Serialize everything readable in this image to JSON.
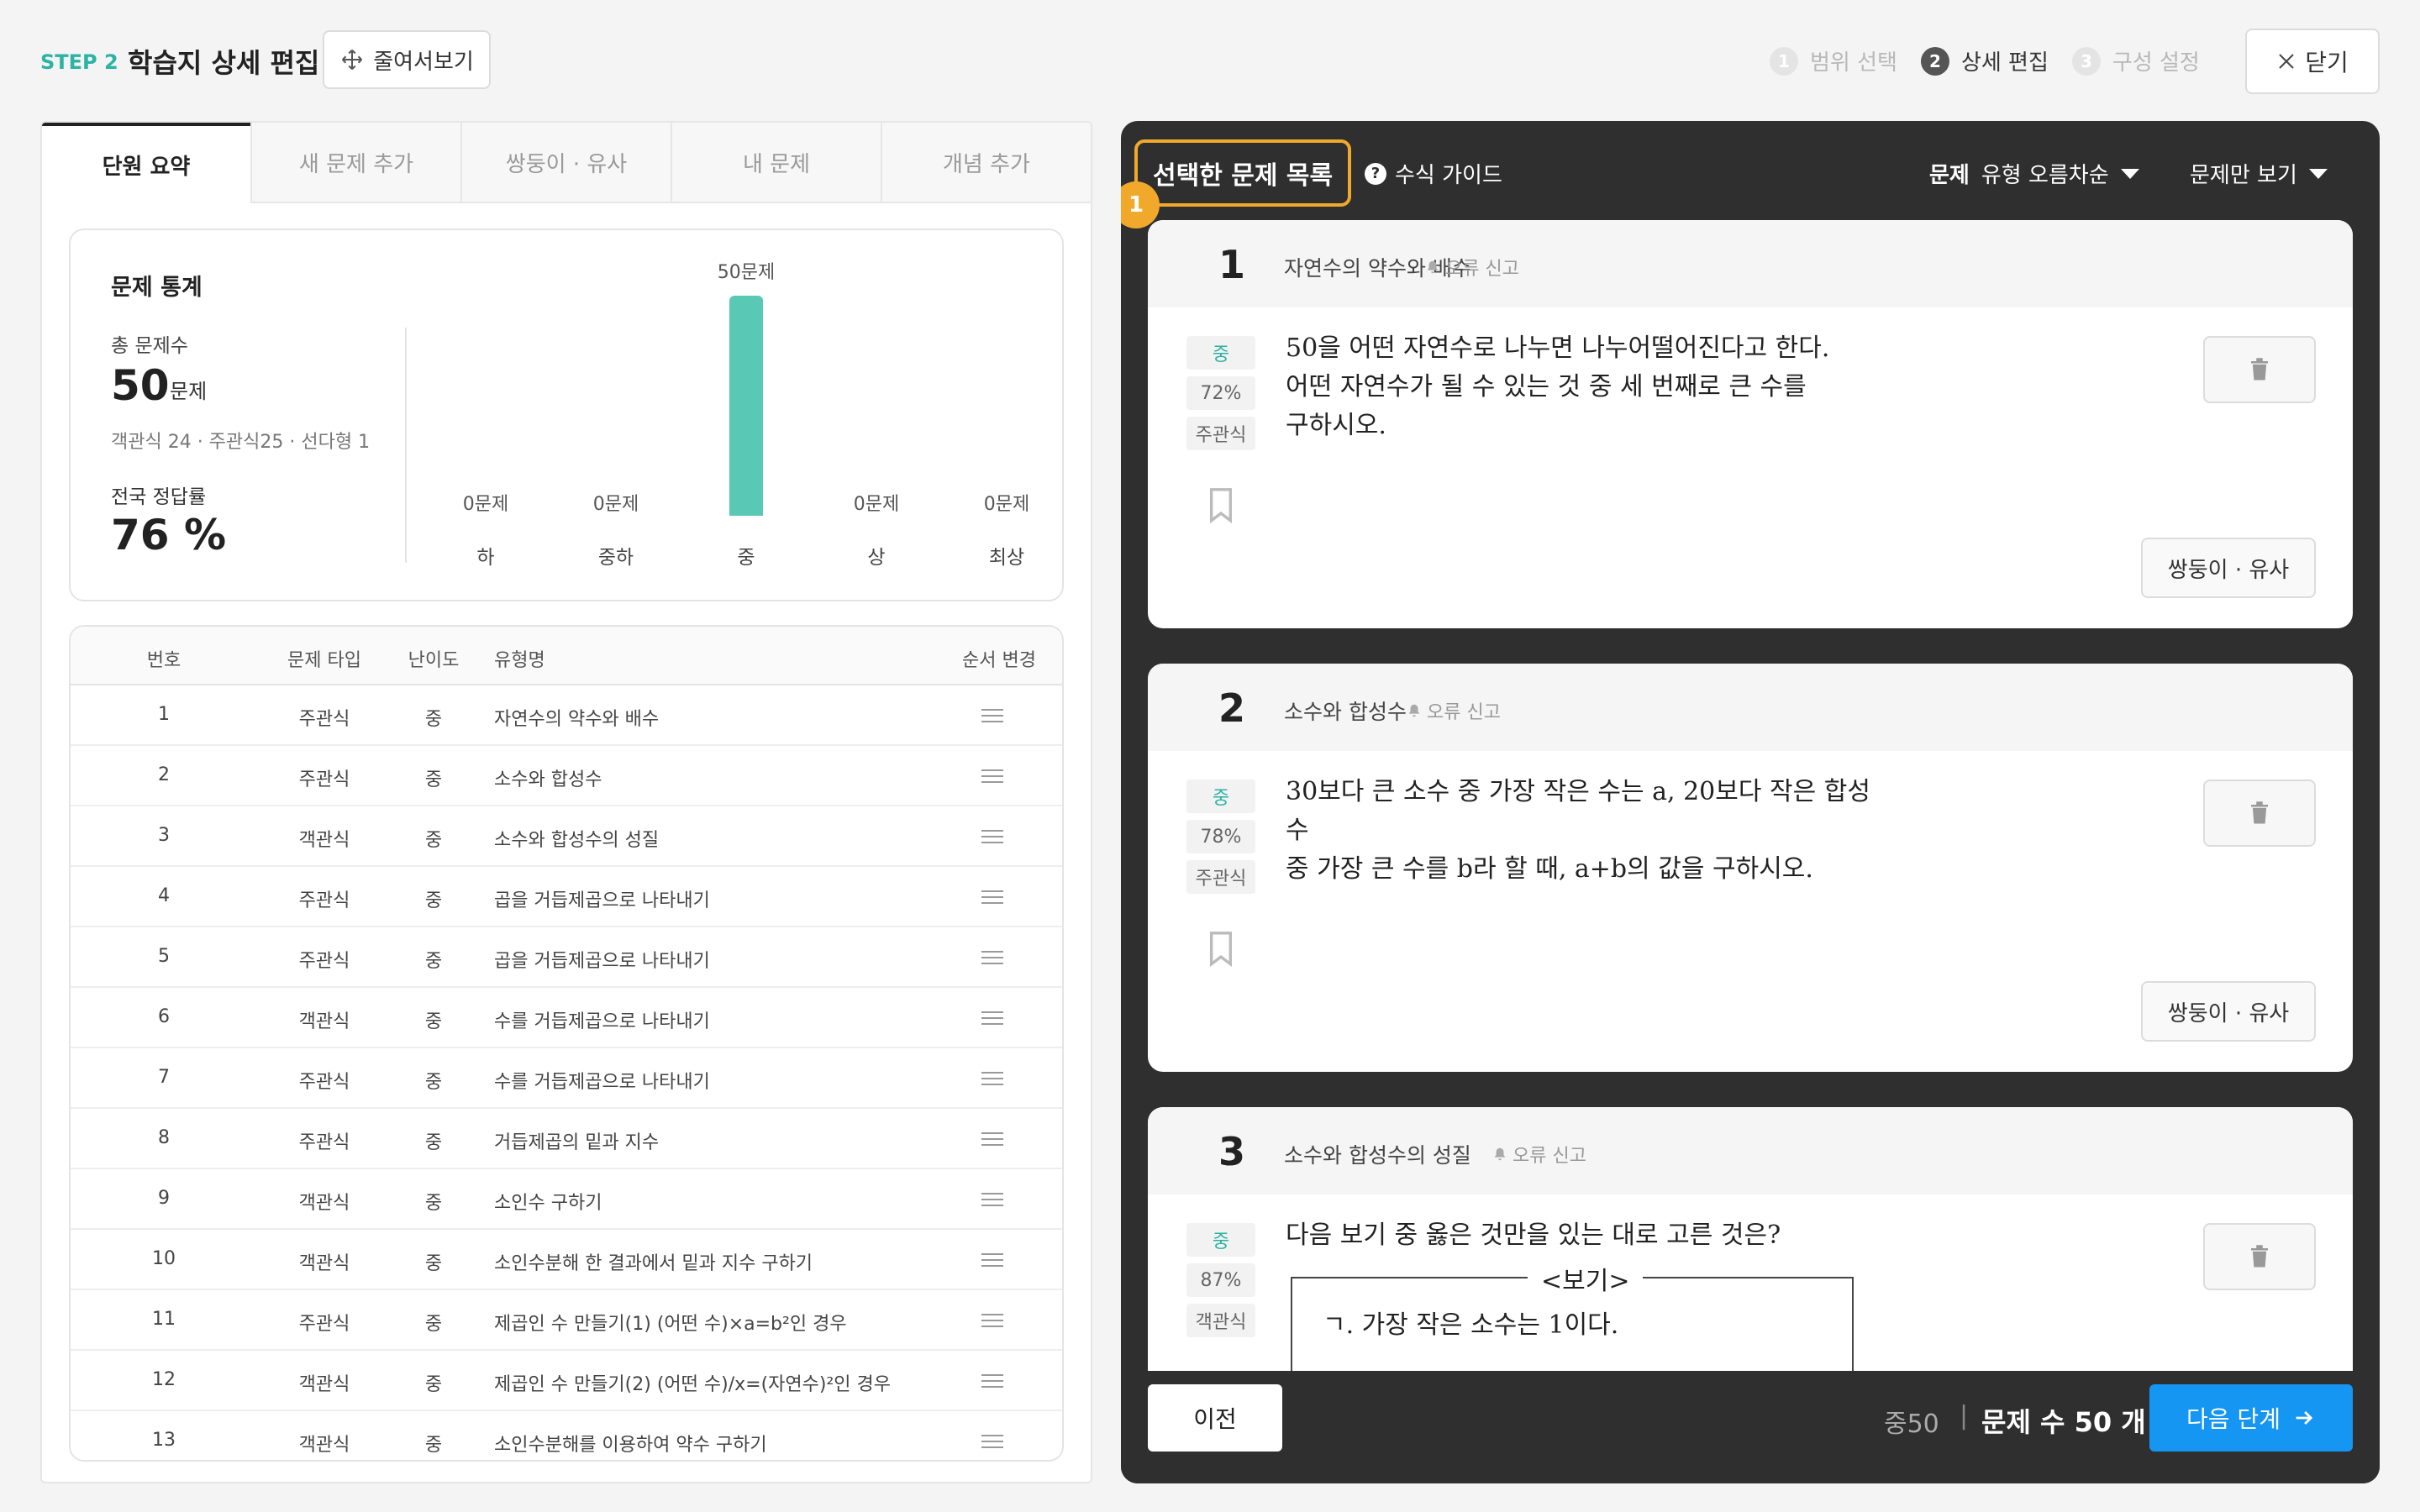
{
  "header": {
    "step_label": "STEP 2",
    "title": "학습지 상세 편집",
    "shrink_label": "줄여서보기",
    "steps": [
      {
        "num": "1",
        "label": "범위 선택",
        "state": "inactive"
      },
      {
        "num": "2",
        "label": "상세 편집",
        "state": "active"
      },
      {
        "num": "3",
        "label": "구성 설정",
        "state": "inactive"
      }
    ],
    "close_label": "닫기"
  },
  "left_tabs": [
    "단원 요약",
    "새 문제 추가",
    "쌍둥이 · 유사",
    "내 문제",
    "개념 추가"
  ],
  "stats": {
    "title": "문제 통계",
    "total_label": "총 문제수",
    "total_value": "50",
    "total_unit": "문제",
    "breakdown": "객관식 24 · 주관식25 · 선다형 1",
    "rate_label": "전국 정답률",
    "rate_value": "76 %"
  },
  "chart_data": {
    "type": "bar",
    "categories": [
      "하",
      "중하",
      "중",
      "상",
      "최상"
    ],
    "values": [
      0,
      0,
      50,
      0,
      0
    ],
    "value_labels": [
      "0문제",
      "0문제",
      "50문제",
      "0문제",
      "0문제"
    ],
    "bar_color": "#59c8b5"
  },
  "table": {
    "headers": [
      "번호",
      "문제 타입",
      "난이도",
      "유형명",
      "순서 변경"
    ],
    "rows": [
      {
        "num": "1",
        "type": "주관식",
        "diff": "중",
        "name": "자연수의 약수와 배수"
      },
      {
        "num": "2",
        "type": "주관식",
        "diff": "중",
        "name": "소수와 합성수"
      },
      {
        "num": "3",
        "type": "객관식",
        "diff": "중",
        "name": "소수와 합성수의 성질"
      },
      {
        "num": "4",
        "type": "주관식",
        "diff": "중",
        "name": "곱을 거듭제곱으로 나타내기"
      },
      {
        "num": "5",
        "type": "주관식",
        "diff": "중",
        "name": "곱을 거듭제곱으로 나타내기"
      },
      {
        "num": "6",
        "type": "객관식",
        "diff": "중",
        "name": "수를 거듭제곱으로 나타내기"
      },
      {
        "num": "7",
        "type": "주관식",
        "diff": "중",
        "name": "수를 거듭제곱으로 나타내기"
      },
      {
        "num": "8",
        "type": "주관식",
        "diff": "중",
        "name": "거듭제곱의 밑과 지수"
      },
      {
        "num": "9",
        "type": "객관식",
        "diff": "중",
        "name": "소인수 구하기"
      },
      {
        "num": "10",
        "type": "객관식",
        "diff": "중",
        "name": "소인수분해 한 결과에서 밑과 지수 구하기"
      },
      {
        "num": "11",
        "type": "주관식",
        "diff": "중",
        "name": "제곱인 수 만들기(1) (어떤 수)×a=b²인 경우"
      },
      {
        "num": "12",
        "type": "객관식",
        "diff": "중",
        "name": "제곱인 수 만들기(2) (어떤 수)/x=(자연수)²인 경우"
      },
      {
        "num": "13",
        "type": "객관식",
        "diff": "중",
        "name": "소인수분해를 이용하여 약수 구하기"
      }
    ]
  },
  "right": {
    "selected_title": "선택한 문제 목록",
    "badge": "1",
    "formula_guide": "수식 가이드",
    "sort_prefix": "문제",
    "sort_label": "유형 오름차순",
    "view_label": "문제만 보기",
    "report_label": "오류 신고",
    "twin_label": "쌍둥이 · 유사",
    "questions": [
      {
        "num": "1",
        "topic": "자연수의 약수와 배수",
        "diff": "중",
        "rate": "72%",
        "type": "주관식",
        "lines": [
          "50을 어떤 자연수로 나누면 나누어떨어진다고 한다.",
          "어떤 자연수가 될 수 있는 것 중 세 번째로 큰 수를",
          "구하시오."
        ]
      },
      {
        "num": "2",
        "topic": "소수와 합성수",
        "diff": "중",
        "rate": "78%",
        "type": "주관식",
        "lines": [
          "30보다 큰 소수 중 가장 작은 수는 a, 20보다 작은 합성수",
          "중 가장 큰 수를 b라 할 때, a+b의 값을 구하시오."
        ]
      },
      {
        "num": "3",
        "topic": "소수와 합성수의 성질",
        "diff": "중",
        "rate": "87%",
        "type": "객관식",
        "lines": [
          "다음 보기 중 옳은 것만을 있는 대로 고른 것은?"
        ],
        "bogi_title": "<보기>",
        "bogi_line": "ㄱ. 가장 작은 소수는 1이다."
      }
    ],
    "prev_label": "이전",
    "footer_summary": "중50",
    "footer_sep": "|",
    "footer_count": "문제 수 50 개",
    "next_label": "다음 단계"
  }
}
